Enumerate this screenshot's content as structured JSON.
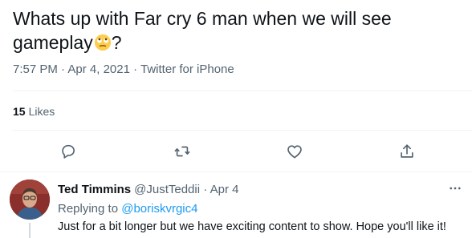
{
  "tweet": {
    "text_line1": "Whats up with Far cry 6 man when we will see",
    "text_line2_start": "gameplay",
    "text_line2_end": "?",
    "emoji": "face-with-rolling-eyes",
    "time": "7:57 PM",
    "sep1": " · ",
    "date": "Apr 4, 2021",
    "sep2": " · ",
    "source": "Twitter for iPhone"
  },
  "stats": {
    "likes_count": "15",
    "likes_label": "Likes"
  },
  "actions": {
    "reply": "reply-icon",
    "retweet": "retweet-icon",
    "like": "heart-icon",
    "share": "share-icon"
  },
  "reply": {
    "name": "Ted Timmins",
    "handle": "@JustTeddii",
    "sep": " · ",
    "time": "Apr 4",
    "replying_label": "Replying to ",
    "replying_to": "@boriskvrgic4",
    "text": "Just for a bit longer but we have exciting content to show. Hope you'll like it!"
  },
  "colors": {
    "text": "#0f1419",
    "secondary": "#536471",
    "link": "#1d9bf0",
    "divider": "#eff3f4"
  }
}
